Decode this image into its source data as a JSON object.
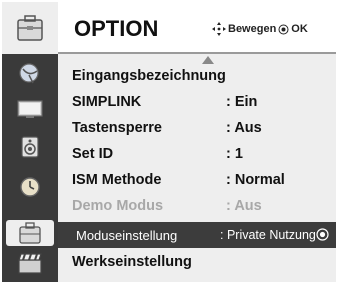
{
  "header": {
    "title": "OPTION",
    "nav_hint": "Bewegen",
    "ok_hint": "OK",
    "nav_icon": "four-way-arrow-icon",
    "ok_icon": "ok-circle-icon"
  },
  "sidebar": {
    "items": [
      {
        "icon": "option-case-icon",
        "active": true
      },
      {
        "icon": "satellite-dish-icon"
      },
      {
        "icon": "tv-picture-icon"
      },
      {
        "icon": "speaker-audio-icon"
      },
      {
        "icon": "clock-timer-icon"
      },
      {
        "icon": "option-case-icon",
        "active": true
      },
      {
        "icon": "clapperboard-icon"
      }
    ]
  },
  "menu": {
    "items": [
      {
        "label": "Eingangsbezeichnung",
        "value": ""
      },
      {
        "label": "SIMPLINK",
        "value": ": Ein"
      },
      {
        "label": "Tastensperre",
        "value": ": Aus"
      },
      {
        "label": "Set ID",
        "value": ": 1"
      },
      {
        "label": "ISM Methode",
        "value": ": Normal"
      },
      {
        "label": "Demo Modus",
        "value": ": Aus",
        "disabled": true
      },
      {
        "label": "Moduseinstellung",
        "value": ": Private Nutzung",
        "selected": true
      },
      {
        "label": "Werkseinstellung",
        "value": ""
      }
    ]
  },
  "colors": {
    "panel": "#eeeeee",
    "frame": "#3a3a3a",
    "selected_row": "#3c3c3c",
    "disabled_text": "#a8a8a8"
  }
}
